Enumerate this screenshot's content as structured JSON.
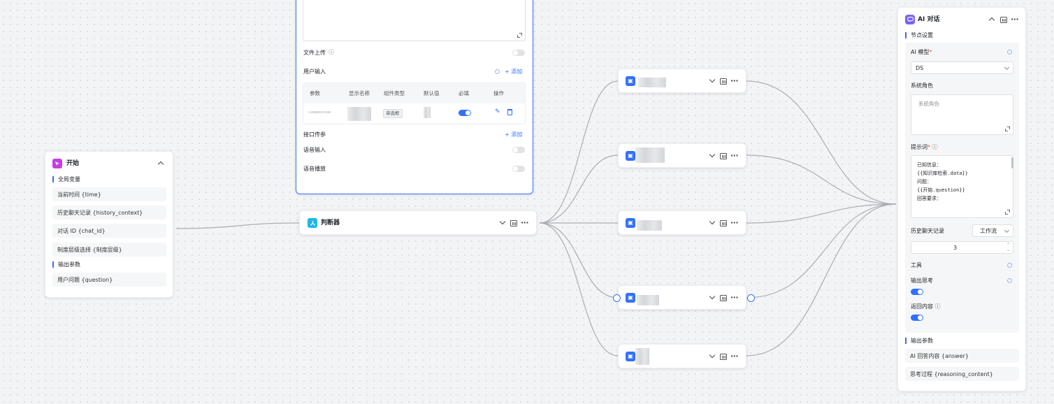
{
  "start_node": {
    "title": "开始",
    "global_vars_label": "全局变量",
    "global_vars": [
      "当前时间 {time}",
      "历史聊天记录 {history_context}",
      "对话 ID {chat_id}",
      "制度层级选择 {制度层级}"
    ],
    "output_label": "输出参数",
    "outputs": [
      "用户问题 {question}"
    ]
  },
  "form_panel": {
    "file_upload_label": "文件上传",
    "user_input_label": "用户输入",
    "add_label": "+ 添加",
    "columns": [
      "参数",
      "显示名称",
      "组件类型",
      "默认值",
      "必填",
      "操作"
    ],
    "row_component_type": "单选框",
    "api_params_label": "接口传参",
    "api_add_label": "+ 添加",
    "voice_input_label": "语音输入",
    "voice_play_label": "语音播放"
  },
  "judge_node": {
    "title": "判断器"
  },
  "branch_count": 5,
  "ai_node": {
    "title": "AI 对话",
    "section_label": "节点设置",
    "model_label": "AI 模型",
    "model_value": "DS",
    "system_role_label": "系统角色",
    "system_role_placeholder": "系统角色",
    "prompt_label": "提示词",
    "prompt_lines": [
      "已知信息：",
      "{{知识库检索.data}}",
      "问题：",
      "{{开始.question}}",
      "回答要求："
    ],
    "history_label": "历史聊天记录",
    "history_type": "工作流",
    "history_count": "3",
    "tools_label": "工具",
    "output_thinking_label": "输出思考",
    "return_content_label": "返回内容",
    "output_label": "输出参数",
    "outputs": [
      "AI 回答内容 {answer}",
      "思考过程 {reasoning_content}"
    ]
  },
  "colors": {
    "accent": "#3370ff",
    "start_icon": "#c43ee6",
    "judge_icon": "#1fb7e6",
    "ai_icon": "#7b61ff"
  }
}
